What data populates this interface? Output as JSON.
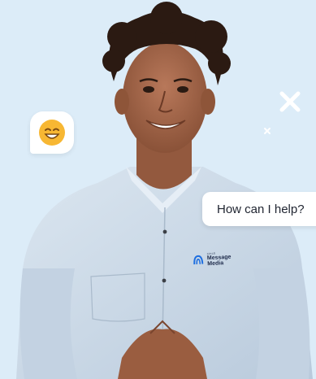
{
  "chat_bubble": {
    "text": "How can I help?"
  },
  "emoji_bubble": {
    "icon": "smiling-face-icon"
  },
  "logo": {
    "line1": "sinch",
    "line2": "Message",
    "line3": "Media",
    "icon": "wave-logo-icon"
  },
  "colors": {
    "background": "#dcecf8",
    "shirt": "#c9d7e6",
    "accent_white": "#ffffff",
    "emoji": "#f7b733"
  }
}
